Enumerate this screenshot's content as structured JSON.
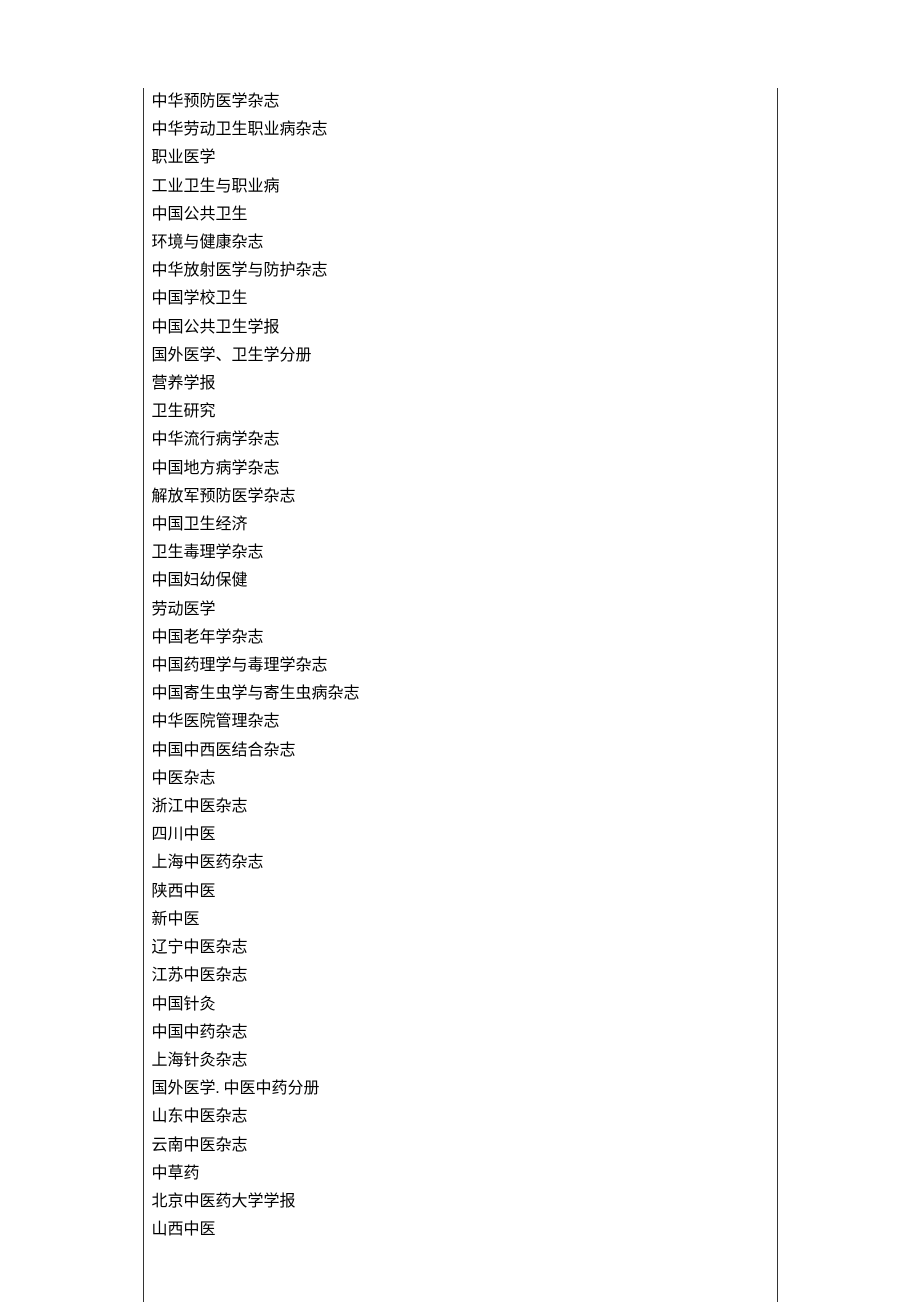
{
  "journals": [
    "中华预防医学杂志",
    "中华劳动卫生职业病杂志",
    "职业医学",
    "工业卫生与职业病",
    "中国公共卫生",
    "环境与健康杂志",
    "中华放射医学与防护杂志",
    "中国学校卫生",
    "中国公共卫生学报",
    "国外医学、卫生学分册",
    "营养学报",
    "卫生研究",
    "中华流行病学杂志",
    "中国地方病学杂志",
    "解放军预防医学杂志",
    "中国卫生经济",
    "卫生毒理学杂志",
    "中国妇幼保健",
    "劳动医学",
    "中国老年学杂志",
    "中国药理学与毒理学杂志",
    "中国寄生虫学与寄生虫病杂志",
    "中华医院管理杂志",
    "中国中西医结合杂志",
    "中医杂志",
    "浙江中医杂志",
    "四川中医",
    "上海中医药杂志",
    "陕西中医",
    "新中医",
    "辽宁中医杂志",
    "江苏中医杂志",
    "中国针灸",
    "中国中药杂志",
    "上海针灸杂志",
    "国外医学. 中医中药分册",
    "山东中医杂志",
    "云南中医杂志",
    "中草药",
    "北京中医药大学学报",
    "山西中医"
  ]
}
